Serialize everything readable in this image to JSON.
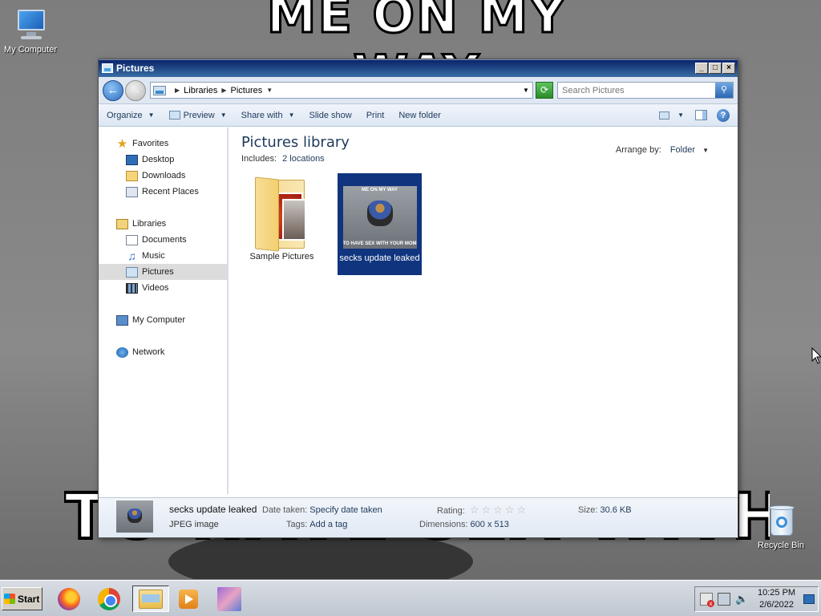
{
  "wallpaper": {
    "top_text": "ME ON MY WAY",
    "bottom_text": "TO HAVE SEX WITH YOUR"
  },
  "desktop_icons": {
    "my_computer": "My Computer",
    "recycle_bin": "Recycle Bin"
  },
  "window": {
    "title": "Pictures",
    "buttons": {
      "minimize": "_",
      "maximize": "□",
      "close": "×"
    }
  },
  "address": {
    "crumbs": [
      "Libraries",
      "Pictures"
    ],
    "search_placeholder": "Search Pictures"
  },
  "toolbar": {
    "organize": "Organize",
    "preview": "Preview",
    "share_with": "Share with",
    "slide_show": "Slide show",
    "print": "Print",
    "new_folder": "New folder"
  },
  "nav": {
    "favorites": "Favorites",
    "desktop": "Desktop",
    "downloads": "Downloads",
    "recent_places": "Recent Places",
    "libraries": "Libraries",
    "documents": "Documents",
    "music": "Music",
    "pictures": "Pictures",
    "videos": "Videos",
    "my_computer": "My Computer",
    "network": "Network"
  },
  "main": {
    "title": "Pictures library",
    "includes_label": "Includes:",
    "includes_value": "2 locations",
    "arrange_label": "Arrange by:",
    "arrange_value": "Folder",
    "items": [
      {
        "label": "Sample Pictures",
        "type": "folder"
      },
      {
        "label": "secks update leaked",
        "type": "image",
        "thumb_top": "ME ON MY WAY",
        "thumb_bottom": "TO HAVE SEX WITH YOUR MOM"
      }
    ]
  },
  "details": {
    "name": "secks update leaked",
    "type": "JPEG image",
    "date_taken_label": "Date taken:",
    "date_taken_value": "Specify date taken",
    "tags_label": "Tags:",
    "tags_value": "Add a tag",
    "rating_label": "Rating:",
    "rating_value": "☆☆☆☆☆",
    "dimensions_label": "Dimensions:",
    "dimensions_value": "600 x 513",
    "size_label": "Size:",
    "size_value": "30.6 KB"
  },
  "taskbar": {
    "start": "Start",
    "time": "10:25 PM",
    "date": "2/6/2022"
  }
}
